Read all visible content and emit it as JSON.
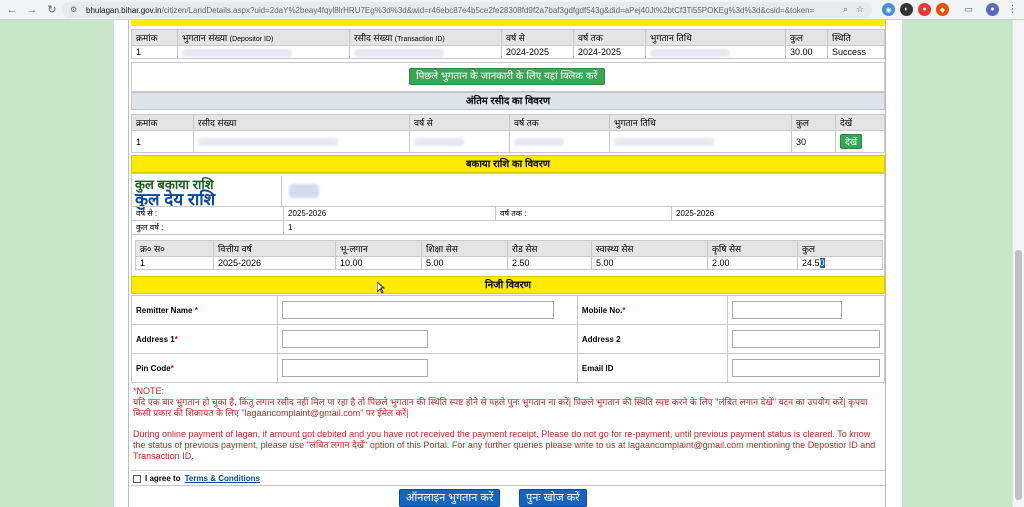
{
  "browser": {
    "url_domain": "bhulagan.bihar.gov.in",
    "url_path": "/citizen/LandDetails.aspx?uid=2daY%2beay4fqyl8lrHRU7Eg%3d%3d&wid=r46ebc87e4b5ce2fe28308fd9f2a7baf3gdfgdf543g&did=aPej40Jt%2btCf3Ti55POKEg%3d%3d&csid=&token="
  },
  "colors": {
    "green_button": "#3aa655",
    "yellow_band": "#ffea00",
    "grey_band": "#dde3ea",
    "blue_button": "#1565c0",
    "note_red": "#c62828"
  },
  "payment_history": {
    "headers": [
      "क्रमांक",
      "भुगतान संख्या",
      "(Depositor ID)",
      "रसीद संख्या",
      "(Transaction ID)",
      "वर्ष से",
      "वर्ष तक",
      "भुगतान तिथि",
      "कुल",
      "स्थिति"
    ],
    "row": {
      "sno": "1",
      "from": "2024-2025",
      "to": "2024-2025",
      "total": "30.00",
      "status": "Success"
    },
    "prev_btn": "पिछले भुगतान के जानकारी के लिए यहां क्लिक करें"
  },
  "last_receipt": {
    "title": "अंतिम रसीद का विवरण",
    "headers": [
      "क्रमांक",
      "रसीद संख्या",
      "वर्ष से",
      "वर्ष तक",
      "भुगतान तिथि",
      "कुल",
      "देखें"
    ],
    "row": {
      "sno": "1",
      "total": "30",
      "view": "देखें"
    }
  },
  "dues": {
    "title": "बकाया राशि का विवरण",
    "total_due_label": "कुल बकाया राशि",
    "total_payable_label": "कुल देय राशि",
    "year_from_label": "वर्ष से :",
    "year_from": "2025-2026",
    "year_to_label": "वर्ष तक :",
    "year_to": "2025-2026",
    "total_years_label": "कुल वर्ष :",
    "total_years": "1",
    "headers": [
      "क्र० स०",
      "वित्तीय वर्ष",
      "भू-लगान",
      "शिक्षा सेस",
      "रोड सेस",
      "स्वास्थ्य सेस",
      "कृषि सेस",
      "कुल"
    ],
    "row": [
      "1",
      "2025-2026",
      "10.00",
      "5.00",
      "2.50",
      "5.00",
      "2.00"
    ],
    "row_total_a": "24.5",
    "row_total_b": "0"
  },
  "personal": {
    "title": "निजी विवरण",
    "remitter_name": "Remitter Name",
    "mobile": "Mobile No.",
    "address1": "Address 1",
    "address2": "Address 2",
    "pincode": "Pin Code",
    "email": "Email ID",
    "star": "*"
  },
  "note": {
    "heading": "*NOTE:",
    "hindi": "यदि एक बार भुगतान हो चुका है, किंतु लगान रसीद नहीं मिल पा रहा है तो पिछले भुगतान की स्थिति स्पष्ट होने से पहले पुनः भुगतान ना करें| पिछले भुगतान की स्थिति स्पष्ट करने के लिए \"लंबित लगान देखें\" बटन का उपयोग करें| कृपया किसी प्रकार की शिकायत के लिए \"lagaancomplaint@gmail.com\" पर ईमेल करें|",
    "english": "During online payment of lagan, if amount got debited and you have not received the payment receipt. Please do not go for re-payment, until previous payment status is cleared. To know the status of previous payment, please use \"लंबित लगान देखें\" option of this Portal. For any further queries please write to us at lagaancomplaint@gmail.com mentioning the Depostior ID and Transaction ID."
  },
  "agree": {
    "text": "I agree to",
    "link": "Terms & Conditions"
  },
  "actions": {
    "pay_online": "ऑनलाइन भुगतान करें",
    "search_again": "पुनः खोज करें"
  }
}
